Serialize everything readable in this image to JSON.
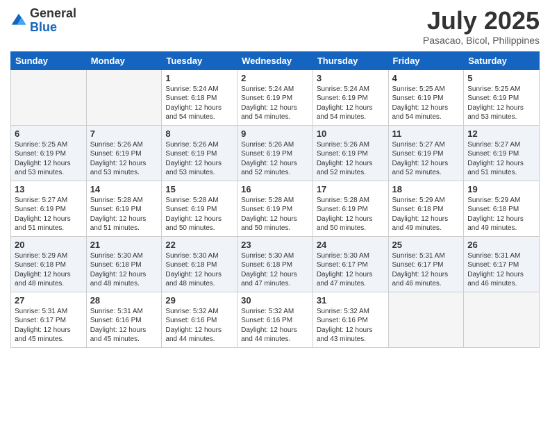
{
  "logo": {
    "general": "General",
    "blue": "Blue"
  },
  "header": {
    "month": "July 2025",
    "location": "Pasacao, Bicol, Philippines"
  },
  "weekdays": [
    "Sunday",
    "Monday",
    "Tuesday",
    "Wednesday",
    "Thursday",
    "Friday",
    "Saturday"
  ],
  "weeks": [
    [
      {
        "day": "",
        "sunrise": "",
        "sunset": "",
        "daylight": ""
      },
      {
        "day": "",
        "sunrise": "",
        "sunset": "",
        "daylight": ""
      },
      {
        "day": "1",
        "sunrise": "Sunrise: 5:24 AM",
        "sunset": "Sunset: 6:18 PM",
        "daylight": "Daylight: 12 hours and 54 minutes."
      },
      {
        "day": "2",
        "sunrise": "Sunrise: 5:24 AM",
        "sunset": "Sunset: 6:19 PM",
        "daylight": "Daylight: 12 hours and 54 minutes."
      },
      {
        "day": "3",
        "sunrise": "Sunrise: 5:24 AM",
        "sunset": "Sunset: 6:19 PM",
        "daylight": "Daylight: 12 hours and 54 minutes."
      },
      {
        "day": "4",
        "sunrise": "Sunrise: 5:25 AM",
        "sunset": "Sunset: 6:19 PM",
        "daylight": "Daylight: 12 hours and 54 minutes."
      },
      {
        "day": "5",
        "sunrise": "Sunrise: 5:25 AM",
        "sunset": "Sunset: 6:19 PM",
        "daylight": "Daylight: 12 hours and 53 minutes."
      }
    ],
    [
      {
        "day": "6",
        "sunrise": "Sunrise: 5:25 AM",
        "sunset": "Sunset: 6:19 PM",
        "daylight": "Daylight: 12 hours and 53 minutes."
      },
      {
        "day": "7",
        "sunrise": "Sunrise: 5:26 AM",
        "sunset": "Sunset: 6:19 PM",
        "daylight": "Daylight: 12 hours and 53 minutes."
      },
      {
        "day": "8",
        "sunrise": "Sunrise: 5:26 AM",
        "sunset": "Sunset: 6:19 PM",
        "daylight": "Daylight: 12 hours and 53 minutes."
      },
      {
        "day": "9",
        "sunrise": "Sunrise: 5:26 AM",
        "sunset": "Sunset: 6:19 PM",
        "daylight": "Daylight: 12 hours and 52 minutes."
      },
      {
        "day": "10",
        "sunrise": "Sunrise: 5:26 AM",
        "sunset": "Sunset: 6:19 PM",
        "daylight": "Daylight: 12 hours and 52 minutes."
      },
      {
        "day": "11",
        "sunrise": "Sunrise: 5:27 AM",
        "sunset": "Sunset: 6:19 PM",
        "daylight": "Daylight: 12 hours and 52 minutes."
      },
      {
        "day": "12",
        "sunrise": "Sunrise: 5:27 AM",
        "sunset": "Sunset: 6:19 PM",
        "daylight": "Daylight: 12 hours and 51 minutes."
      }
    ],
    [
      {
        "day": "13",
        "sunrise": "Sunrise: 5:27 AM",
        "sunset": "Sunset: 6:19 PM",
        "daylight": "Daylight: 12 hours and 51 minutes."
      },
      {
        "day": "14",
        "sunrise": "Sunrise: 5:28 AM",
        "sunset": "Sunset: 6:19 PM",
        "daylight": "Daylight: 12 hours and 51 minutes."
      },
      {
        "day": "15",
        "sunrise": "Sunrise: 5:28 AM",
        "sunset": "Sunset: 6:19 PM",
        "daylight": "Daylight: 12 hours and 50 minutes."
      },
      {
        "day": "16",
        "sunrise": "Sunrise: 5:28 AM",
        "sunset": "Sunset: 6:19 PM",
        "daylight": "Daylight: 12 hours and 50 minutes."
      },
      {
        "day": "17",
        "sunrise": "Sunrise: 5:28 AM",
        "sunset": "Sunset: 6:19 PM",
        "daylight": "Daylight: 12 hours and 50 minutes."
      },
      {
        "day": "18",
        "sunrise": "Sunrise: 5:29 AM",
        "sunset": "Sunset: 6:18 PM",
        "daylight": "Daylight: 12 hours and 49 minutes."
      },
      {
        "day": "19",
        "sunrise": "Sunrise: 5:29 AM",
        "sunset": "Sunset: 6:18 PM",
        "daylight": "Daylight: 12 hours and 49 minutes."
      }
    ],
    [
      {
        "day": "20",
        "sunrise": "Sunrise: 5:29 AM",
        "sunset": "Sunset: 6:18 PM",
        "daylight": "Daylight: 12 hours and 48 minutes."
      },
      {
        "day": "21",
        "sunrise": "Sunrise: 5:30 AM",
        "sunset": "Sunset: 6:18 PM",
        "daylight": "Daylight: 12 hours and 48 minutes."
      },
      {
        "day": "22",
        "sunrise": "Sunrise: 5:30 AM",
        "sunset": "Sunset: 6:18 PM",
        "daylight": "Daylight: 12 hours and 48 minutes."
      },
      {
        "day": "23",
        "sunrise": "Sunrise: 5:30 AM",
        "sunset": "Sunset: 6:18 PM",
        "daylight": "Daylight: 12 hours and 47 minutes."
      },
      {
        "day": "24",
        "sunrise": "Sunrise: 5:30 AM",
        "sunset": "Sunset: 6:17 PM",
        "daylight": "Daylight: 12 hours and 47 minutes."
      },
      {
        "day": "25",
        "sunrise": "Sunrise: 5:31 AM",
        "sunset": "Sunset: 6:17 PM",
        "daylight": "Daylight: 12 hours and 46 minutes."
      },
      {
        "day": "26",
        "sunrise": "Sunrise: 5:31 AM",
        "sunset": "Sunset: 6:17 PM",
        "daylight": "Daylight: 12 hours and 46 minutes."
      }
    ],
    [
      {
        "day": "27",
        "sunrise": "Sunrise: 5:31 AM",
        "sunset": "Sunset: 6:17 PM",
        "daylight": "Daylight: 12 hours and 45 minutes."
      },
      {
        "day": "28",
        "sunrise": "Sunrise: 5:31 AM",
        "sunset": "Sunset: 6:16 PM",
        "daylight": "Daylight: 12 hours and 45 minutes."
      },
      {
        "day": "29",
        "sunrise": "Sunrise: 5:32 AM",
        "sunset": "Sunset: 6:16 PM",
        "daylight": "Daylight: 12 hours and 44 minutes."
      },
      {
        "day": "30",
        "sunrise": "Sunrise: 5:32 AM",
        "sunset": "Sunset: 6:16 PM",
        "daylight": "Daylight: 12 hours and 44 minutes."
      },
      {
        "day": "31",
        "sunrise": "Sunrise: 5:32 AM",
        "sunset": "Sunset: 6:16 PM",
        "daylight": "Daylight: 12 hours and 43 minutes."
      },
      {
        "day": "",
        "sunrise": "",
        "sunset": "",
        "daylight": ""
      },
      {
        "day": "",
        "sunrise": "",
        "sunset": "",
        "daylight": ""
      }
    ]
  ]
}
